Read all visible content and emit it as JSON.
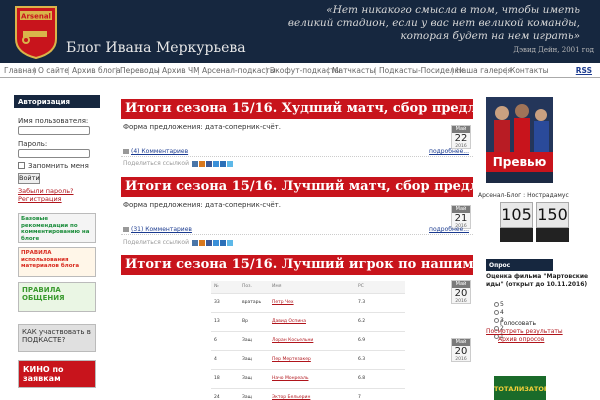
{
  "header": {
    "blog_title": "Блог Ивана Меркурьева",
    "crest_text": "Arsenal",
    "quote": "«Нет никакого смысла в том, чтобы иметь великий стадион, если у вас нет великой команды, которая будет на нем играть»",
    "quote_author": "Дэвид Дейн, 2001 год"
  },
  "nav": {
    "items": [
      "Главная",
      "О сайте",
      "Архив блога",
      "Переводы",
      "Архив ЧМ",
      "Арсенал-подкасты",
      "Экофут-подкасты",
      "Матчкасты",
      "Подкасты-Посиделки",
      "Наша галерея",
      "Контакты"
    ],
    "rss": "RSS"
  },
  "login": {
    "heading": "Авторизация",
    "username_label": "Имя пользователя:",
    "password_label": "Пароль:",
    "remember_label": "Запомнить меня",
    "login_button": "Войти",
    "forgot_link": "Забыли пароль?",
    "register_link": "Регистрация"
  },
  "banners": [
    {
      "text": "Базовые рекомендации по комментированию на блоге",
      "color": "#1a8c3a"
    },
    {
      "text": "ПРАВИЛА использования материалов блога",
      "color": "#d82a1e"
    },
    {
      "text": "ПРАВИЛА ОБЩЕНИЯ",
      "color": "#3a9a2e"
    },
    {
      "text": "КАК участвовать в ПОДКАСТЕ?",
      "color": "#e0e0e0"
    },
    {
      "text": "КИНО по заявкам",
      "color": "#c8141c"
    }
  ],
  "posts": [
    {
      "title": "Итоги сезона 15/16. Худший матч, сбор предложений",
      "text": "Форма предложения: дата-соперник-счёт.",
      "month": "Май",
      "day": "22",
      "year": "2016",
      "comments": "(4) Комментариев",
      "more": "подробнее...",
      "share": "Поделиться ссылкой"
    },
    {
      "title": "Итоги сезона 15/16. Лучший матч, сбор предложений",
      "text": "Форма предложения: дата-соперник-счёт.",
      "month": "Май",
      "day": "21",
      "year": "2016",
      "comments": "(31) Комментариев",
      "more": "подробнее...",
      "share": "Поделиться ссылкой"
    },
    {
      "title": "Итоги сезона 15/16. Лучший игрок по нашим опросам",
      "month": "Май",
      "day": "20",
      "year": "2016",
      "table": {
        "headers": [
          "№",
          "Поз.",
          "Имя",
          "РС"
        ],
        "rows": [
          [
            "33",
            "вратарь",
            "Петр Чех",
            "7.3"
          ],
          [
            "13",
            "Вр",
            "Давид Оспина",
            "6.2"
          ],
          [
            "6",
            "Защ",
            "Лоран Косьельни",
            "6.9"
          ],
          [
            "4",
            "Защ",
            "Пер Мертезакер",
            "6.3"
          ],
          [
            "18",
            "Защ",
            "Начо Монреаль",
            "6.8"
          ],
          [
            "24",
            "Защ",
            "Эктор Бельерин",
            "7"
          ]
        ]
      }
    }
  ],
  "right": {
    "preview_label": "Превью",
    "counter_label": "Арсенал-Блог : Нострадамус",
    "counter_left": "105",
    "counter_right": "150",
    "poll_heading": "Опрос",
    "poll_question": "Оценка фильма \"Мартовские иды\" (открыт до 10.11.2016)",
    "poll_options": [
      "5",
      "4",
      "3",
      "2",
      "1"
    ],
    "vote_button": "Голосовать",
    "results_link": "Посмотреть результаты",
    "archive_link": "Архив опросов",
    "toto_text": "ТОТАЛИЗАТОР"
  },
  "colors": {
    "accent": "#c8141c",
    "navy": "#16273f",
    "link": "#1a3a8f"
  }
}
